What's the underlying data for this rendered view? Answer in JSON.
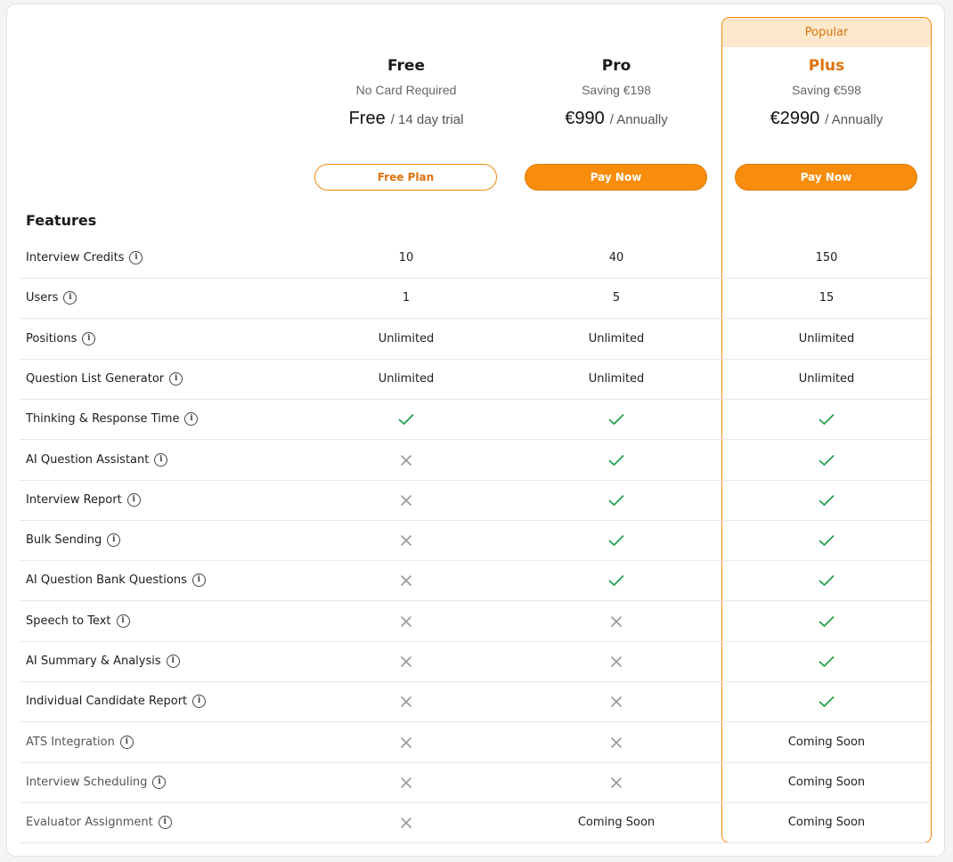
{
  "popular_label": "Popular",
  "plans": [
    {
      "name": "Free",
      "subtitle": "No Card Required",
      "price": "Free",
      "period": "/ 14 day trial",
      "button": "Free Plan"
    },
    {
      "name": "Pro",
      "subtitle": "Saving €198",
      "price": "€990",
      "period": "/ Annually",
      "button": "Pay Now"
    },
    {
      "name": "Plus",
      "subtitle": "Saving €598",
      "price": "€2990",
      "period": "/ Annually",
      "button": "Pay Now"
    }
  ],
  "features_title": "Features",
  "colors": {
    "accent": "#f88c0c",
    "plus_name": "#e0720a",
    "check": "#22a04a",
    "cross": "#9a9a9a",
    "popular_bg": "#fde8cc"
  },
  "features": [
    {
      "name": "Interview Credits",
      "values": [
        "10",
        "40",
        "150"
      ]
    },
    {
      "name": "Users",
      "values": [
        "1",
        "5",
        "15"
      ]
    },
    {
      "name": "Positions",
      "values": [
        "Unlimited",
        "Unlimited",
        "Unlimited"
      ]
    },
    {
      "name": "Question List Generator",
      "values": [
        "Unlimited",
        "Unlimited",
        "Unlimited"
      ]
    },
    {
      "name": "Thinking & Response Time",
      "values": [
        "check",
        "check",
        "check"
      ]
    },
    {
      "name": "AI Question Assistant",
      "values": [
        "cross",
        "check",
        "check"
      ]
    },
    {
      "name": "Interview Report",
      "values": [
        "cross",
        "check",
        "check"
      ]
    },
    {
      "name": "Bulk Sending",
      "values": [
        "cross",
        "check",
        "check"
      ]
    },
    {
      "name": "AI Question Bank Questions",
      "values": [
        "cross",
        "check",
        "check"
      ]
    },
    {
      "name": "Speech to Text",
      "values": [
        "cross",
        "cross",
        "check"
      ]
    },
    {
      "name": "AI Summary & Analysis",
      "values": [
        "cross",
        "cross",
        "check"
      ]
    },
    {
      "name": "Individual Candidate Report",
      "values": [
        "cross",
        "cross",
        "check"
      ]
    },
    {
      "name": "ATS Integration",
      "values": [
        "cross",
        "cross",
        "Coming Soon"
      ]
    },
    {
      "name": "Interview Scheduling",
      "values": [
        "cross",
        "cross",
        "Coming Soon"
      ]
    },
    {
      "name": "Evaluator Assignment",
      "values": [
        "cross",
        "Coming Soon",
        "Coming Soon"
      ]
    }
  ]
}
